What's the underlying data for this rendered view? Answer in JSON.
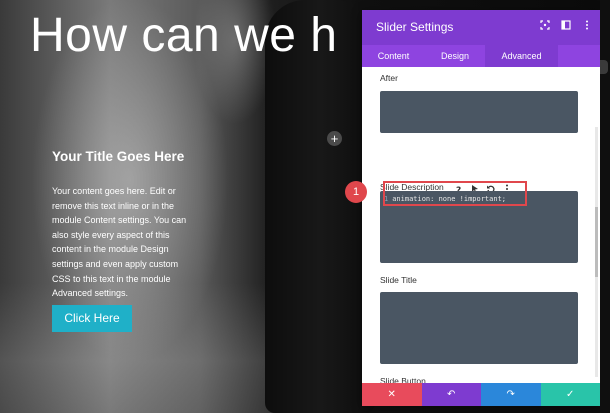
{
  "hero": {
    "heading": "How can we h",
    "slide_title": "Your Title Goes Here",
    "slide_text": "Your content goes here. Edit or remove this text inline or in the module Content settings. You can also style every aspect of this content in the module Design settings and even apply custom CSS to this text in the module Advanced settings.",
    "button_label": "Click Here",
    "plus_glyph": "+"
  },
  "panel": {
    "title": "Slider Settings",
    "header_icons": [
      "expand-icon",
      "sidebar-toggle-icon",
      "more-icon"
    ],
    "tabs": [
      {
        "label": "Content",
        "active": false
      },
      {
        "label": "Design",
        "active": false
      },
      {
        "label": "Advanced",
        "active": true
      }
    ],
    "fields": {
      "after_label": "After",
      "slide_description_label": "Slide Description",
      "slide_description_code_line_number": "1",
      "slide_description_code": "animation: none !important;",
      "slide_title_label": "Slide Title",
      "slide_button_label": "Slide Button"
    },
    "label_icons": [
      "help-icon",
      "pointer-icon",
      "reset-icon",
      "more-icon"
    ],
    "footer": {
      "cancel": "✕",
      "undo": "↶",
      "redo": "↷",
      "save": "✓"
    }
  },
  "annotation": {
    "step_number": "1"
  },
  "colors": {
    "panel_header": "#7e3bd0",
    "tab_bar": "#8e44e0",
    "field_bg": "#4a5663",
    "highlight": "#e0474c",
    "cta": "#1fb0c8",
    "footer_cancel": "#e84b5c",
    "footer_undo": "#7e3bd0",
    "footer_redo": "#2b87da",
    "footer_save": "#29c4a9"
  }
}
